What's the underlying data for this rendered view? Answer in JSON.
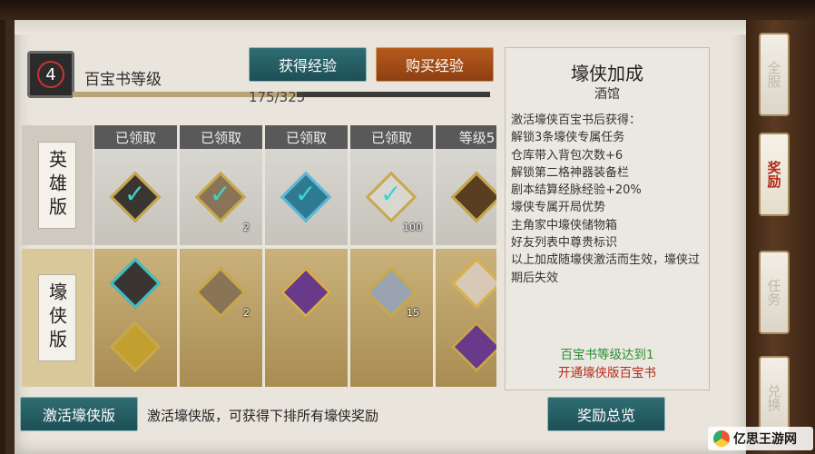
{
  "header": {
    "level": "4",
    "level_label": "百宝书等级",
    "progress_text": "175/325",
    "progress_fraction": 0.538,
    "gain_exp_button": "获得经验",
    "buy_exp_button": "购买经验"
  },
  "rows": {
    "hero_label": "英雄版",
    "tycoon_label": "壕侠版"
  },
  "columns": [
    {
      "header": "已领取",
      "top_qty": "",
      "bottom_qty": ""
    },
    {
      "header": "已领取",
      "top_qty": "2",
      "bottom_qty": "2"
    },
    {
      "header": "已领取",
      "top_qty": "",
      "bottom_qty": ""
    },
    {
      "header": "已领取",
      "top_qty": "100",
      "bottom_qty": "15"
    },
    {
      "header": "等级5",
      "top_qty": "",
      "bottom_qty": ""
    }
  ],
  "panel": {
    "title": "壕侠加成",
    "subtitle": "酒馆",
    "description": "激活壕侠百宝书后获得：\n解锁3条壕侠专属任务\n仓库带入背包次数+6\n解锁第二格神器装备栏\n剧本结算经脉经验+20%\n壕侠专属开局优势\n主角家中壕侠储物箱\n好友列表中尊贵标识\n以上加成随壕侠激活而生效，壕侠过期后失效",
    "condition": "百宝书等级达到1",
    "unlock": "开通壕侠版百宝书"
  },
  "footer": {
    "activate_button": "激活壕侠版",
    "activate_hint": "激活壕侠版，可获得下排所有壕侠奖励",
    "overview_button": "奖励总览"
  },
  "side_tabs": [
    "全服",
    "奖励",
    "任务",
    "兑换"
  ],
  "watermark": "亿思王游网",
  "colors": {
    "teal_button": "#1d4f56",
    "orange_button": "#8d3f12",
    "condition_green": "#2b8f32",
    "unlock_red": "#b82a1a",
    "check_cyan": "#3fd3d0"
  }
}
